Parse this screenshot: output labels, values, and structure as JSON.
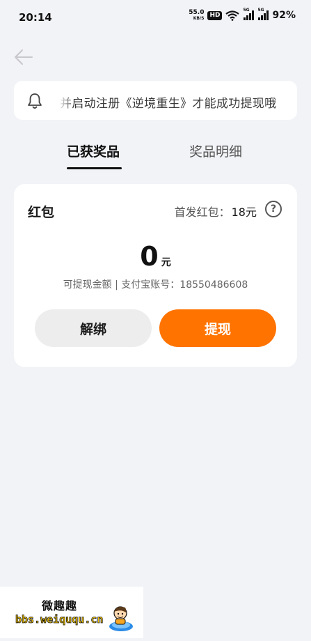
{
  "status_bar": {
    "time": "20:14",
    "net_speed": "55.0",
    "net_speed_unit": "KB/S",
    "hd_badge": "HD",
    "signal_1_label": "5G",
    "signal_2_label": "5G",
    "battery": "92%"
  },
  "notice": {
    "text": "并启动注册《逆境重生》才能成功提现哦"
  },
  "tabs": [
    {
      "label": "已获奖品",
      "active": true
    },
    {
      "label": "奖品明细",
      "active": false
    }
  ],
  "card": {
    "title": "红包",
    "first_pack_label": "首发红包：",
    "first_pack_amount": "18元",
    "help_symbol": "?",
    "balance": "0",
    "balance_unit": "元",
    "info": "可提现金额 | 支付宝账号：18550486608",
    "unbind_label": "解绑",
    "withdraw_label": "提现"
  },
  "watermark": {
    "line1": "微趣趣",
    "line2": "bbs.weiququ.cn"
  },
  "colors": {
    "accent": "#ff7300",
    "background": "#f2f3f7",
    "card": "#ffffff",
    "unbind_button": "#ededed"
  },
  "icons": {
    "back": "arrow-left-icon",
    "notice": "bell-icon",
    "help": "question-circle-icon"
  }
}
